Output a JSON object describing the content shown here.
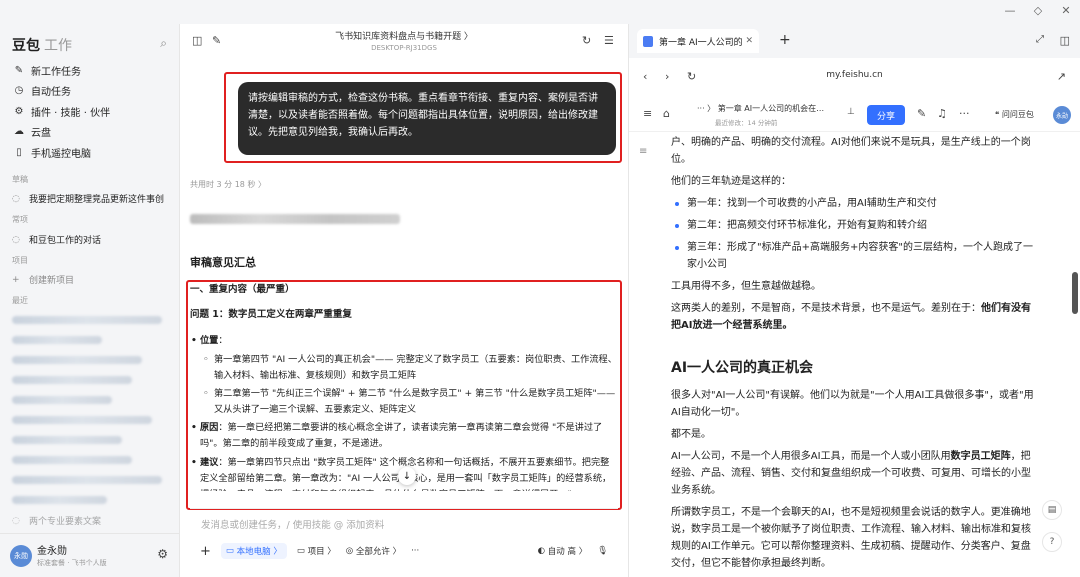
{
  "window": {
    "minimize": "—",
    "restore": "◇",
    "close": "✕"
  },
  "sidebar": {
    "brand": "豆包",
    "brand_sub": "工作",
    "nav": [
      {
        "icon": "✎",
        "label": "新工作任务"
      },
      {
        "icon": "◷",
        "label": "自动任务"
      },
      {
        "icon": "⚙",
        "label": "插件 · 技能 · 伙伴"
      },
      {
        "icon": "☁",
        "label": "云盘"
      },
      {
        "icon": "▯",
        "label": "手机遥控电脑"
      }
    ],
    "section_drafts": "草稿",
    "draft_item": "我要把定期整理竞品更新这件事创",
    "section_common": "常项",
    "common_item": "和豆包工作的对话",
    "section_projects": "项目",
    "new_project": "创建新项目",
    "section_recent": "最近",
    "recent_visible": "两个专业要素文案",
    "user": {
      "avatar": "永勋",
      "name": "金永勋",
      "sub": "标准套餐 · 飞书个人版"
    }
  },
  "chat": {
    "title": "飞书知识库资料盘点与书籍开题 〉",
    "device": "DESKTOP-RJ31DGS",
    "user_message": "请按编辑审稿的方式，检查这份书稿。重点看章节衔接、重复内容、案例是否讲清楚，以及读者能否照着做。每个问题都指出具体位置，说明原因，给出修改建议。先把意见列给我，我确认后再改。",
    "elapsed": "共用时 3 分 18 秒 〉",
    "review_heading": "审稿意见汇总",
    "section1": "一、重复内容（最严重）",
    "problem1": "问题 1：数字员工定义在两章严重重复",
    "loc_label": "位置",
    "loc_colon": "：",
    "loc1": "第一章第四节 \"AI 一人公司的真正机会\"—— 完整定义了数字员工（五要素：岗位职责、工作流程、输入材料、输出标准、复核规则）和数字员工矩阵",
    "loc2": "第二章第一节 \"先纠正三个误解\" + 第二节 \"什么是数字员工\" + 第三节 \"什么是数字员工矩阵\"—— 又从头讲了一遍三个误解、五要素定义、矩阵定义",
    "reason_label": "原因",
    "reason": "：第一章已经把第二章要讲的核心概念全讲了，读者读完第一章再读第二章会觉得 \"不是讲过了吗\"。第二章的前半段变成了重复，不是递进。",
    "suggest_label": "建议",
    "suggest": "：第一章第四节只点出 \"数字员工矩阵\" 这个概念名称和一句话概括，不展开五要素细节。把完整定义全部留给第二章。第一章改为：\"AI 一人公司的核心，是用一套叫「数字员工矩阵」的经营系统，把经验、产品、流程、交付和复盘组织起来。具体什么是数字员工矩阵，下一章详细展开。\"",
    "composer_placeholder": "发消息或创建任务，/ 使用技能 @ 添加资料",
    "chips": {
      "add": "+",
      "computer": "本地电脑 〉",
      "project": "项目 〉",
      "permission": "全部允许 〉",
      "more": "···",
      "auto": "自动 高 〉"
    }
  },
  "doc": {
    "tab_title": "第一章 AI一人公司的",
    "url": "my.feishu.cn",
    "breadcrumb": "··· 〉 第一章 AI一人公司的机会在…",
    "edited": "最近修改：14 分钟前",
    "share": "分享",
    "ask": "问问豆包",
    "avatar": "永勋",
    "p1": "户、明确的产品、明确的交付流程。AI对他们来说不是玩具，是生产线上的一个岗位。",
    "p2": "他们的三年轨迹是这样的：",
    "list": [
      "第一年：找到一个可收费的小产品，用AI辅助生产和交付",
      "第二年：把高频交付环节标准化，开始有复购和转介绍",
      "第三年：形成了\"标准产品+高端服务+内容获客\"的三层结构，一个人跑成了一家小公司"
    ],
    "p3": "工具用得不多，但生意越做越稳。",
    "p4_a": "这两类人的差别，不是智商，不是技术背景，也不是运气。差别在于：",
    "p4_b": "他们有没有把AI放进一个经营系统里。",
    "h2": "AI一人公司的真正机会",
    "p5": "很多人对\"AI一人公司\"有误解。他们以为就是\"一个人用AI工具做很多事\"，或者\"用AI自动化一切\"。",
    "p6": "都不是。",
    "p7_a": "AI一人公司，不是一个人用很多AI工具，而是一个人或小团队用",
    "p7_b": "数字员工矩阵",
    "p7_c": "，把经验、产品、流程、销售、交付和复盘组织成一个可收费、可复用、可增长的小型业务系统。",
    "p8": "所谓数字员工，不是一个会聊天的AI，也不是短视频里会说话的数字人。更准确地说，数字员工是一个被你赋予了岗位职责、工作流程、输入材料、输出标准和复核规则的AI工作单元。它可以帮你整理资料、生成初稿、提醒动作、分类客户、复盘交付，但它不能替你承担最终判断。"
  }
}
